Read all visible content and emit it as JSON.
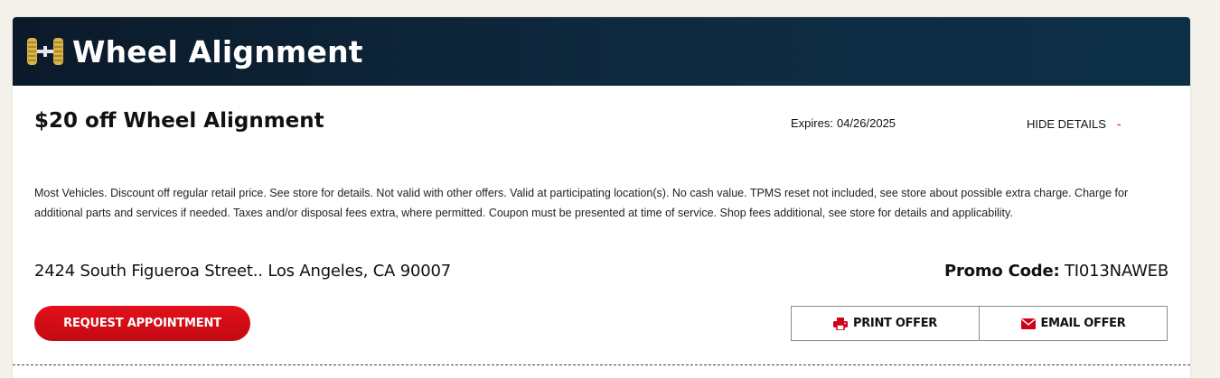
{
  "header": {
    "title": "Wheel Alignment",
    "icon": "wheel-alignment-icon"
  },
  "offer": {
    "title": "$20 off Wheel Alignment",
    "expires_label": "Expires:",
    "expires_date": "04/26/2025",
    "hide_details_label": "HIDE DETAILS",
    "hide_details_symbol": "-",
    "disclaimer": "Most Vehicles. Discount off regular retail price. See store for details. Not valid with other offers. Valid at participating location(s). No cash value. TPMS reset not included, see store about possible extra charge. Charge for additional parts and services if needed. Taxes and/or disposal fees extra, where permitted. Coupon must be presented at time of service. Shop fees additional, see store for details and applicability.",
    "address": "2424 South Figueroa Street.. Los Angeles, CA 90007",
    "promo_label": "Promo Code:",
    "promo_code": "TI013NAWEB"
  },
  "actions": {
    "request_label": "REQUEST APPOINTMENT",
    "print_label": "PRINT OFFER",
    "email_label": "EMAIL OFFER"
  },
  "colors": {
    "header_bg": "#0f2a40",
    "accent_red": "#d0021b",
    "page_bg": "#f4f1ea",
    "icon_gold": "#d9b34a"
  }
}
